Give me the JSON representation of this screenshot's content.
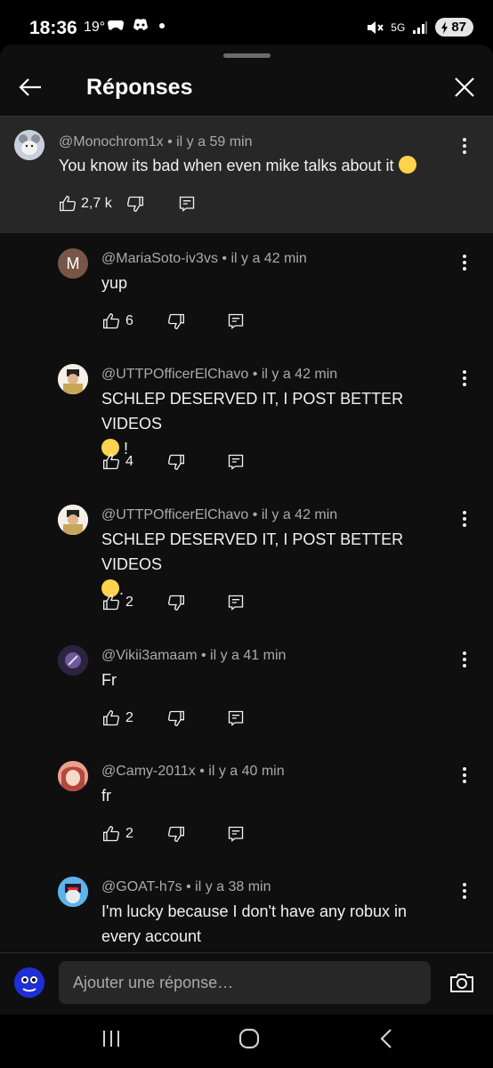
{
  "status": {
    "time": "18:36",
    "temp": "19°",
    "network": "5G",
    "battery": "87"
  },
  "header": {
    "title": "Réponses"
  },
  "parent_comment": {
    "author": "@Monochrom1x",
    "time": "il y a 59 min",
    "text": "You know its bad when even mike talks about it",
    "likes": "2,7 k"
  },
  "replies": [
    {
      "author": "@MariaSoto-iv3vs",
      "time": "il y a 42 min",
      "text": "yup",
      "likes": "6",
      "avatar_letter": "M"
    },
    {
      "author": "@UTTPOfficerElChavo",
      "time": "il y a 42 min",
      "text": "SCHLEP DESERVED IT, I POST BETTER VIDEOS",
      "text_suffix": " !",
      "likes": "4"
    },
    {
      "author": "@UTTPOfficerElChavo",
      "time": "il y a 42 min",
      "text": "SCHLEP DESERVED IT, I POST BETTER VIDEOS",
      "text_suffix": ".",
      "likes": "2"
    },
    {
      "author": "@Vikii3amaam",
      "time": "il y a 41 min",
      "text": "Fr",
      "likes": "2"
    },
    {
      "author": "@Camy-2011x",
      "time": "il y a 40 min",
      "text": "fr",
      "likes": "2"
    },
    {
      "author": "@GOAT-h7s",
      "time": "il y a 38 min",
      "text": "I'm lucky because I don't have any robux in every account"
    }
  ],
  "composer": {
    "placeholder": "Ajouter une réponse…"
  },
  "colors": {
    "background": "#0f0f0f",
    "parent_highlight": "#272727",
    "secondary_text": "#aaaaaa"
  }
}
